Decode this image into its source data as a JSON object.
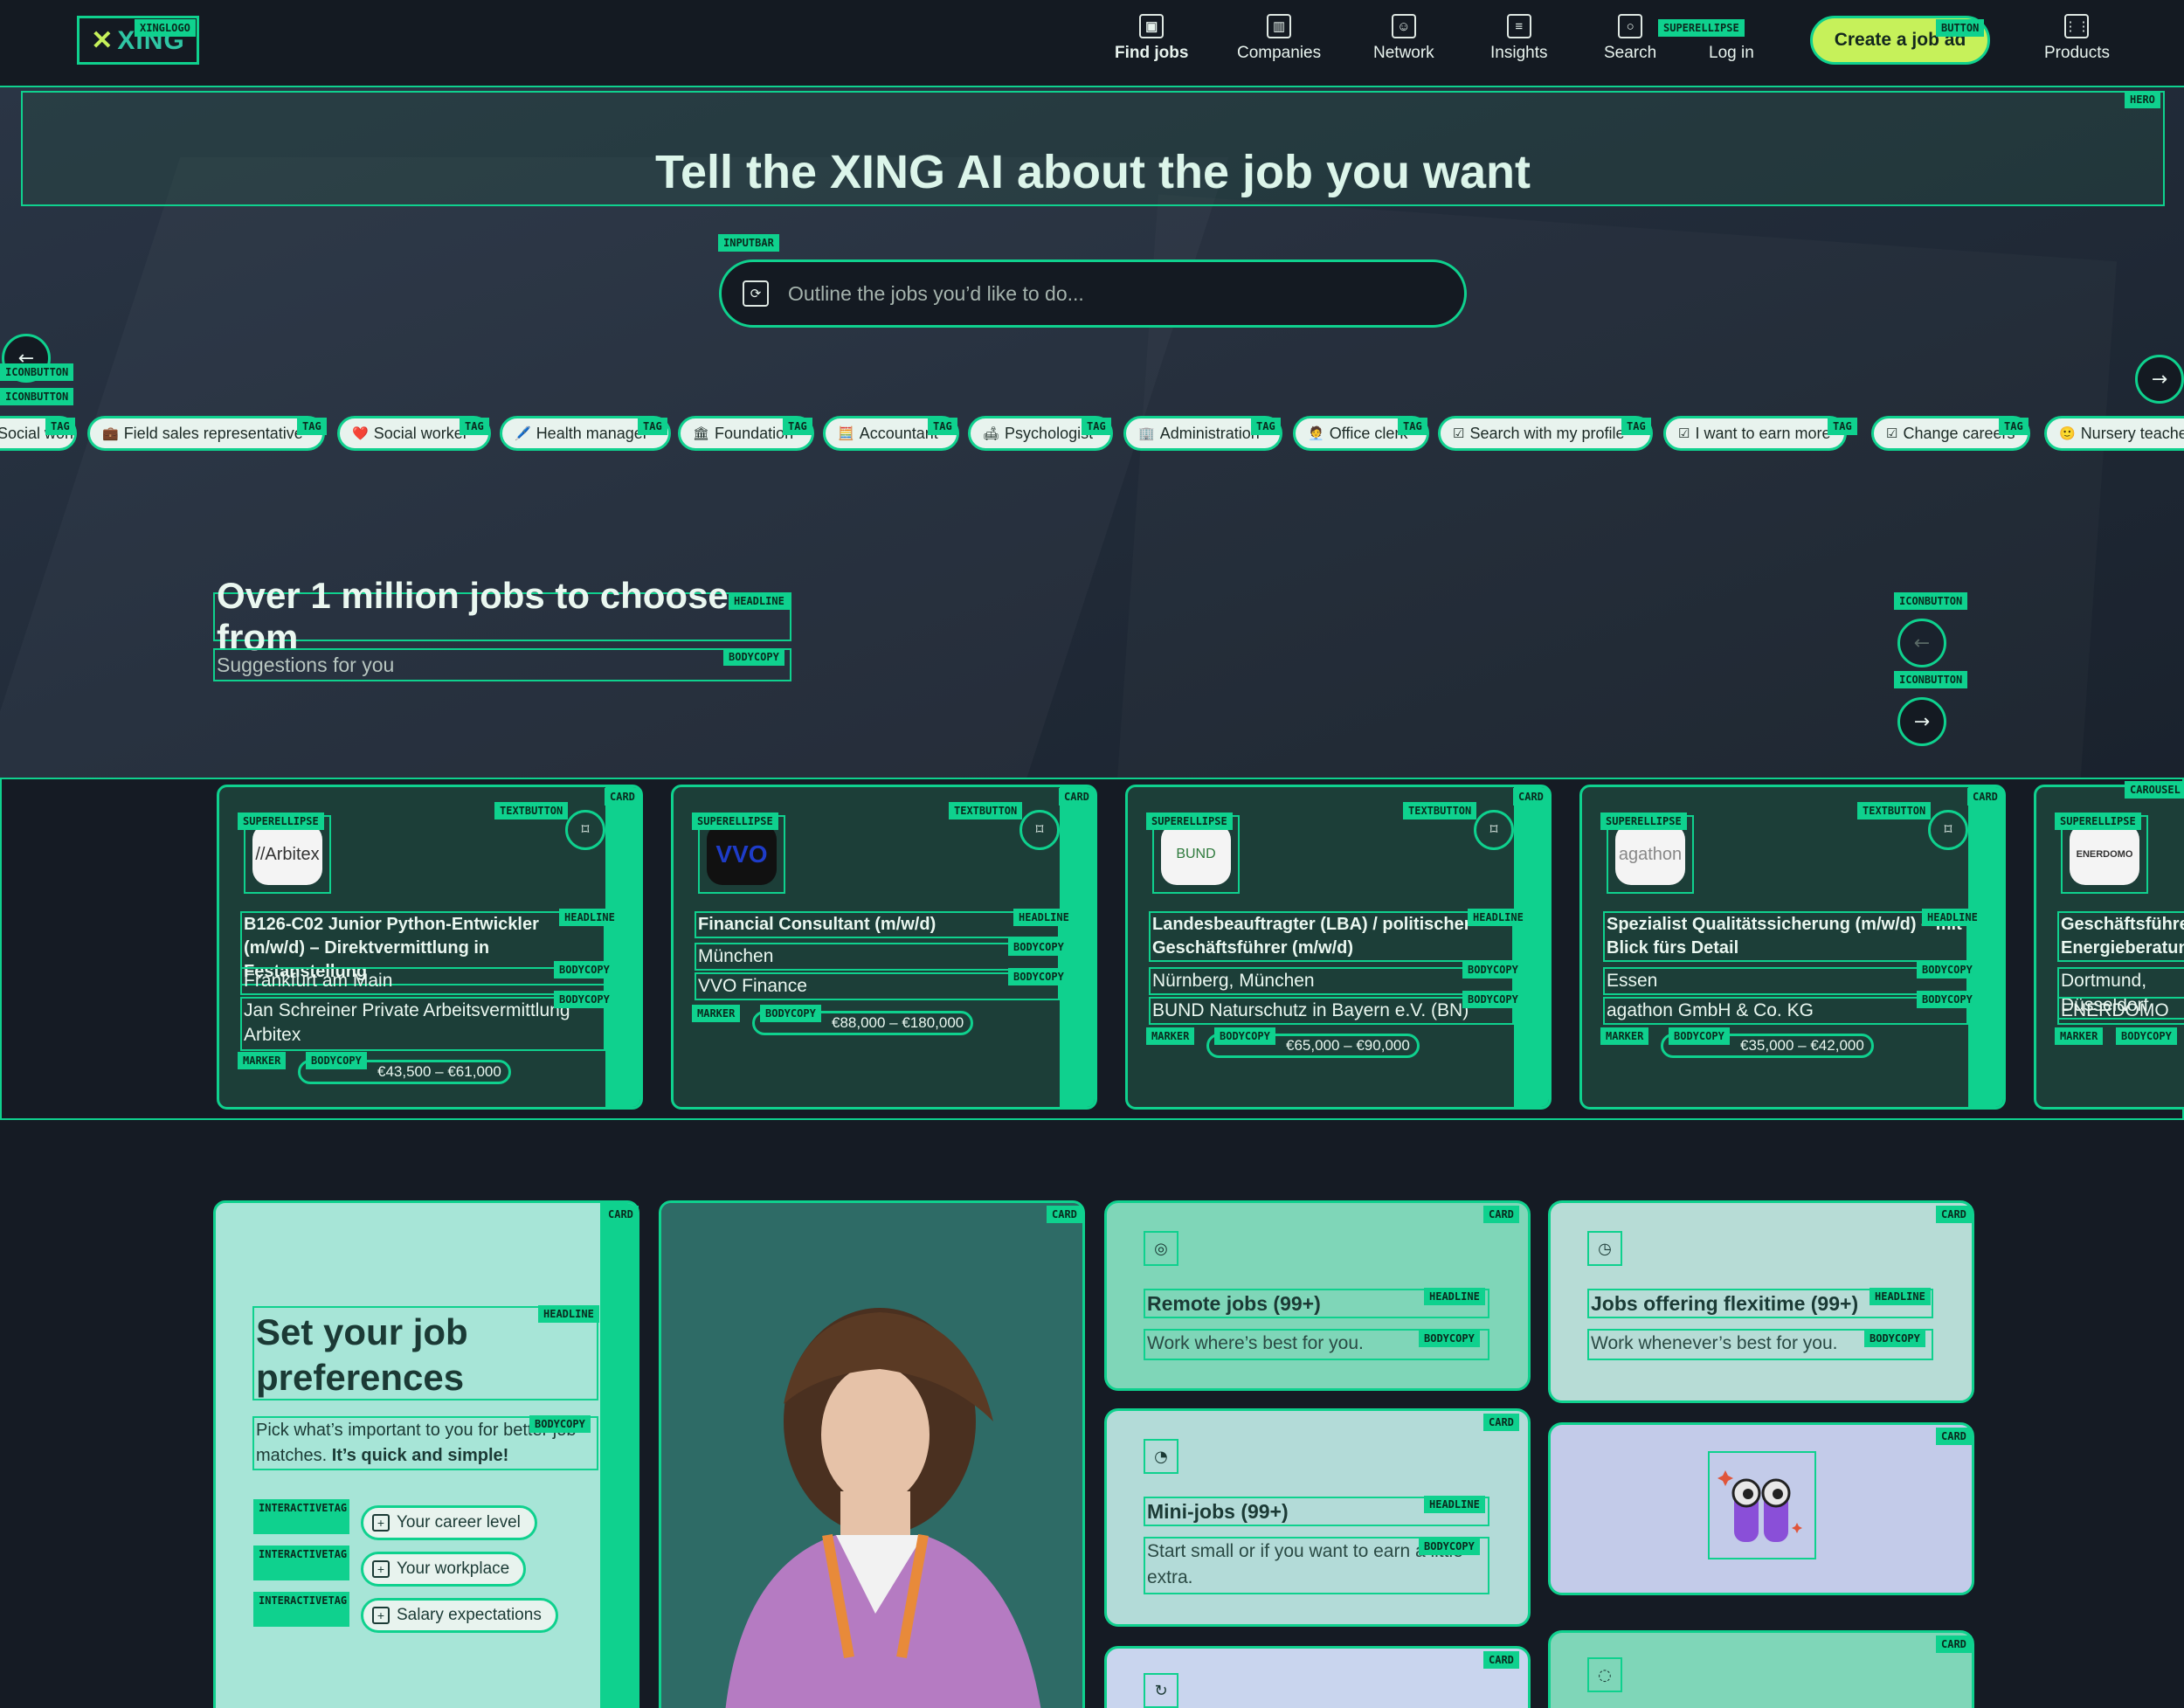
{
  "header": {
    "logo": "XING",
    "nav": [
      {
        "label": "Find jobs",
        "icon": "briefcase-icon"
      },
      {
        "label": "Companies",
        "icon": "building-icon"
      },
      {
        "label": "Network",
        "icon": "people-icon"
      },
      {
        "label": "Insights",
        "icon": "news-icon"
      },
      {
        "label": "Search",
        "icon": "search-icon"
      },
      {
        "label": "Log in",
        "icon": ""
      },
      {
        "label": "Products",
        "icon": "grid-icon"
      }
    ],
    "create_button": "Create a job ad"
  },
  "hero": {
    "title": "Tell the XING AI about the job you want",
    "search_placeholder": "Outline the jobs you’d like to do...",
    "tags": [
      {
        "label": "Social worker",
        "emoji": ""
      },
      {
        "label": "Field sales representative",
        "emoji": "💼"
      },
      {
        "label": "Social worker",
        "emoji": "❤️"
      },
      {
        "label": "Health manager",
        "emoji": "🖊️"
      },
      {
        "label": "Foundation",
        "emoji": "🏛"
      },
      {
        "label": "Accountant",
        "emoji": "🧮"
      },
      {
        "label": "Psychologist",
        "emoji": "🛋"
      },
      {
        "label": "Administration",
        "emoji": "🏢"
      },
      {
        "label": "Office clerk",
        "emoji": "🧑‍💼"
      },
      {
        "label": "Search with my profile",
        "emoji": "☑"
      },
      {
        "label": "I want to earn more",
        "emoji": "☑"
      },
      {
        "label": "Change careers",
        "emoji": "☑"
      },
      {
        "label": "Nursery teacher",
        "emoji": "🙂"
      }
    ]
  },
  "suggestions": {
    "headline": "Over 1 million jobs to choose from",
    "subline": "Suggestions for you"
  },
  "jobs": [
    {
      "logo": "//Arbitex",
      "title": "B126-C02 Junior Python-Entwickler (m/w/d) – Direktvermittlung in Festanstellung",
      "location": "Frankfurt am Main",
      "company": "Jan Schreiner Private Arbeitsvermittlung Arbitex",
      "salary": "€43,500 – €61,000"
    },
    {
      "logo": "VVO",
      "title": "Financial Consultant (m/w/d)",
      "location": "München",
      "company": "VVO Finance",
      "salary": "€88,000 – €180,000"
    },
    {
      "logo": "BUND",
      "title": "Landesbeauftragter (LBA) / politischer Geschäftsführer (m/w/d)",
      "location": "Nürnberg, München",
      "company": "BUND Naturschutz in Bayern e.V. (BN)",
      "salary": "€65,000 – €90,000"
    },
    {
      "logo": "agathon",
      "title": "Spezialist Qualitätssicherung (m/w/d) – mit Blick fürs Detail",
      "location": "Essen",
      "company": "agathon GmbH & Co. KG",
      "salary": "€35,000 – €42,000"
    },
    {
      "logo": "ENERDOMO",
      "title": "Geschäftsführer Energieberatung",
      "location": "Dortmund, Düsseldorf",
      "company": "ENERDOMO",
      "salary": ""
    }
  ],
  "preferences": {
    "headline": "Set your job preferences",
    "body_plain": "Pick what’s important to you for better job matches. ",
    "body_bold": "It’s quick and simple!",
    "tags": [
      "Your career level",
      "Your workplace",
      "Salary expectations"
    ]
  },
  "tiles": [
    {
      "headline": "Remote jobs (99+)",
      "body": "Work where’s best for you.",
      "icon": "globe-icon"
    },
    {
      "headline": "Jobs offering flexitime (99+)",
      "body": "Work whenever’s best for you.",
      "icon": "clock-icon"
    },
    {
      "headline": "Mini-jobs (99+)",
      "body": "Start small or if you want to earn a little extra.",
      "icon": "piggybank-icon"
    }
  ],
  "annotations": {
    "xinglogo": "XINGLOGO",
    "superellipse": "SUPERELLIPSE",
    "button": "BUTTON",
    "hero": "HERO",
    "inputbar": "INPUTBAR",
    "iconbutton": "ICONBUTTON",
    "tag": "TAG",
    "headline": "HEADLINE",
    "bodycopy": "BODYCOPY",
    "card": "CARD",
    "carousel": "CAROUSEL",
    "textbutton": "TEXTBUTTON",
    "marker": "MARKER",
    "interactivetag": "INTERACTIVETAG"
  },
  "colors": {
    "accent": "#0fd18e",
    "lime": "#c6f15a",
    "dark": "#151b24"
  }
}
